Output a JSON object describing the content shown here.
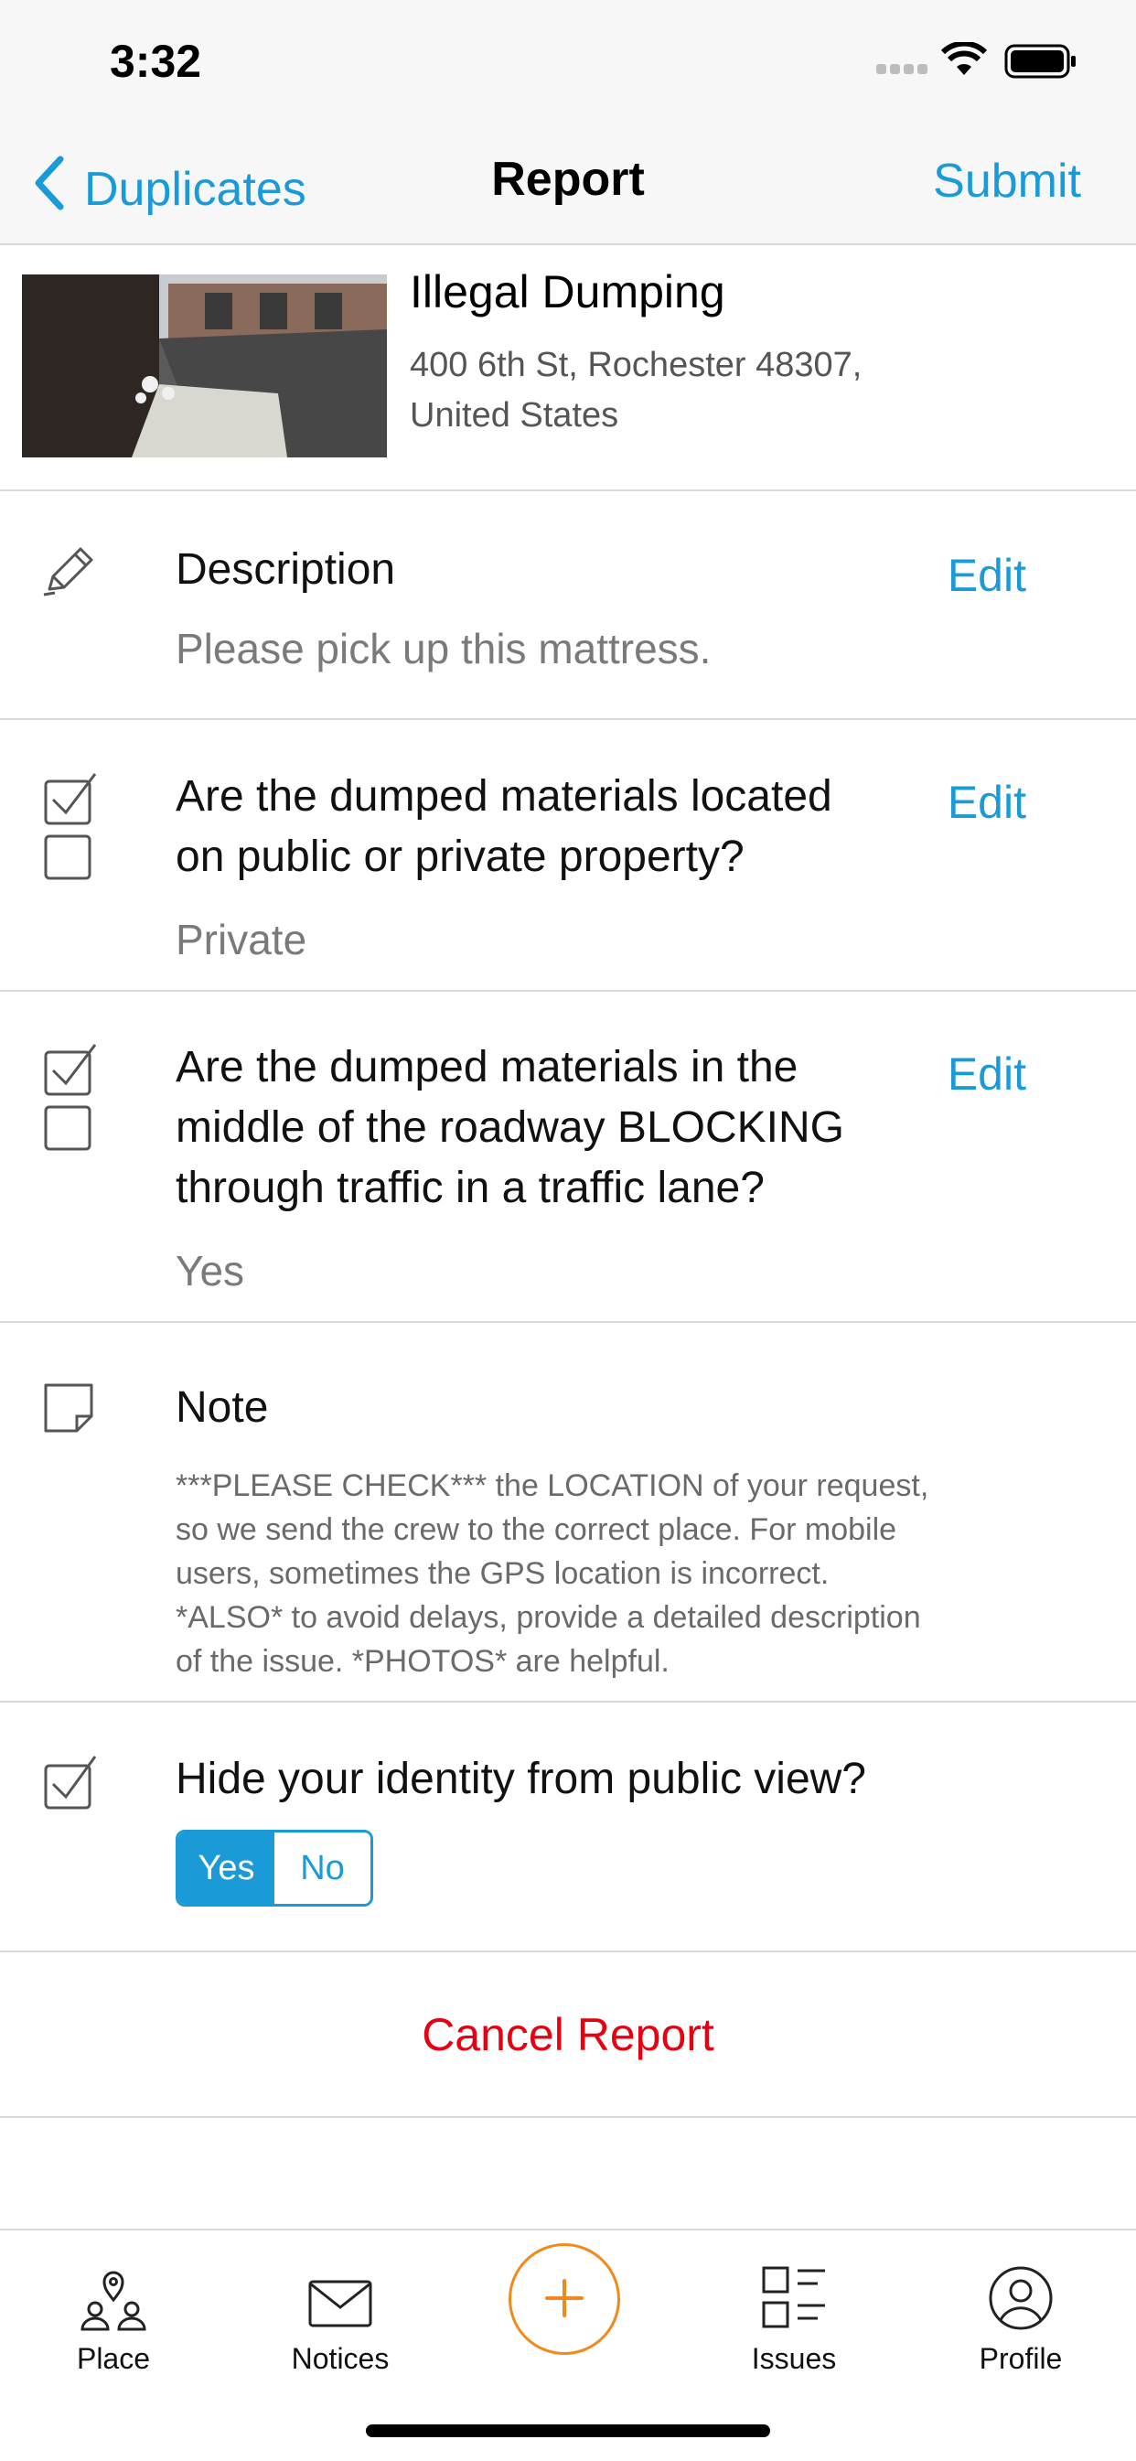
{
  "status_bar": {
    "time": "3:32"
  },
  "nav": {
    "back_label": "Duplicates",
    "title": "Report",
    "submit_label": "Submit"
  },
  "issue": {
    "title": "Illegal Dumping",
    "address_line1": "400 6th St, Rochester 48307,",
    "address_line2": "United States"
  },
  "description": {
    "label": "Description",
    "value": "Please pick up this mattress.",
    "edit_label": "Edit"
  },
  "q1": {
    "line1": "Are the dumped materials located",
    "line2": "on public or private property?",
    "value": "Private",
    "edit_label": "Edit"
  },
  "q2": {
    "line1": "Are the dumped materials in the",
    "line2": "middle of the roadway BLOCKING",
    "line3": "through traffic in a traffic lane?",
    "value": "Yes",
    "edit_label": "Edit"
  },
  "note": {
    "label": "Note",
    "line1": "***PLEASE CHECK*** the LOCATION of your request,",
    "line2": "so we send the crew to the correct place. For mobile",
    "line3": "users, sometimes the GPS location is incorrect.",
    "line4": "*ALSO* to avoid delays, provide a detailed description",
    "line5": "of the issue. *PHOTOS* are helpful."
  },
  "hide_identity": {
    "label": "Hide your identity from public view?",
    "yes": "Yes",
    "no": "No",
    "selected": "Yes"
  },
  "cancel_label": "Cancel Report",
  "tabs": [
    {
      "label": "Place",
      "icon": "place-icon"
    },
    {
      "label": "Notices",
      "icon": "envelope-icon"
    },
    {
      "label": "",
      "icon": "plus-icon"
    },
    {
      "label": "Issues",
      "icon": "issues-list-icon"
    },
    {
      "label": "Profile",
      "icon": "profile-icon"
    }
  ],
  "colors": {
    "accent": "#1a9bd7",
    "danger": "#e60012",
    "fab": "#f08a1c"
  }
}
